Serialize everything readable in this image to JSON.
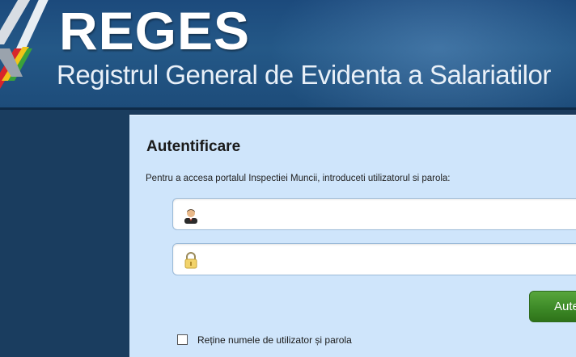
{
  "header": {
    "brand": "REGES",
    "subtitle": "Registrul General de Evidenta a Salariatilor"
  },
  "login": {
    "title": "Autentificare",
    "instructions": "Pentru a accesa portalul Inspectiei Muncii, introduceti utilizatorul si parola:",
    "username": {
      "value": "",
      "icon": "user-icon"
    },
    "password": {
      "value": "",
      "icon": "lock-icon"
    },
    "submit_label": "Autentificare",
    "remember_label": "Reține numele de utilizator și parola",
    "remember_checked": false
  },
  "colors": {
    "header_bg": "#245887",
    "panel_bg": "#cfe5fb",
    "button_green": "#3d8a27",
    "left_panel": "#1a3d5f"
  }
}
